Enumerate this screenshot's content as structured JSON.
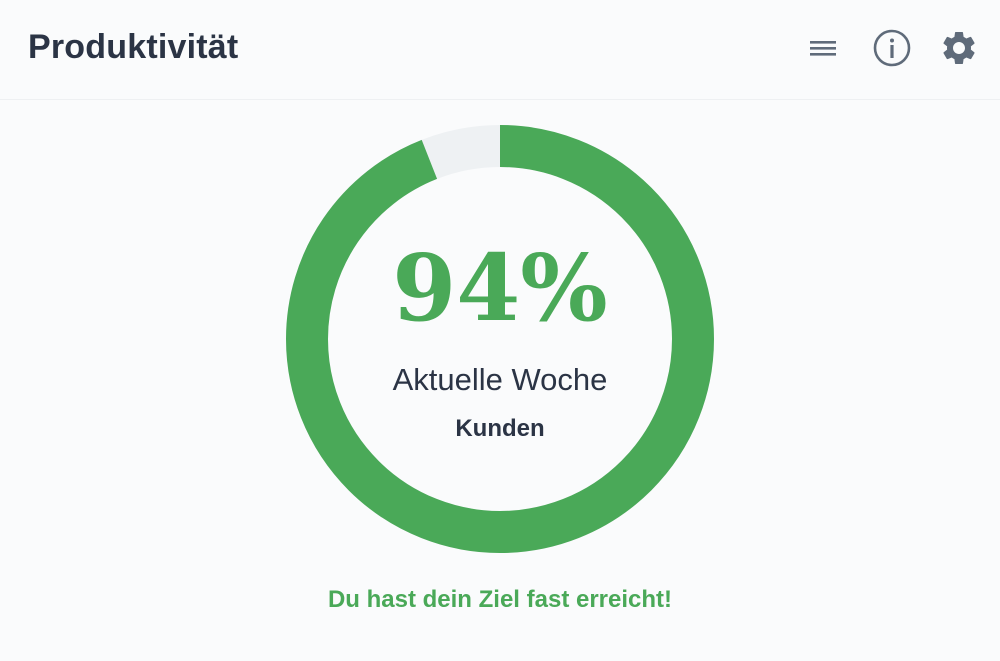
{
  "header": {
    "title": "Produktivität",
    "icons": {
      "menu": "menu-icon",
      "info": "info-icon",
      "settings": "gear-icon"
    }
  },
  "widget": {
    "progress_fraction": 0.94,
    "percent_label": "94%",
    "period_label": "Aktuelle Woche",
    "category_label": "Kunden",
    "message": "Du hast dein Ziel fast erreicht!"
  },
  "colors": {
    "accent": "#4aa958",
    "track": "#eef1f3",
    "text": "#2b3445",
    "icon": "#5f6b7a"
  }
}
